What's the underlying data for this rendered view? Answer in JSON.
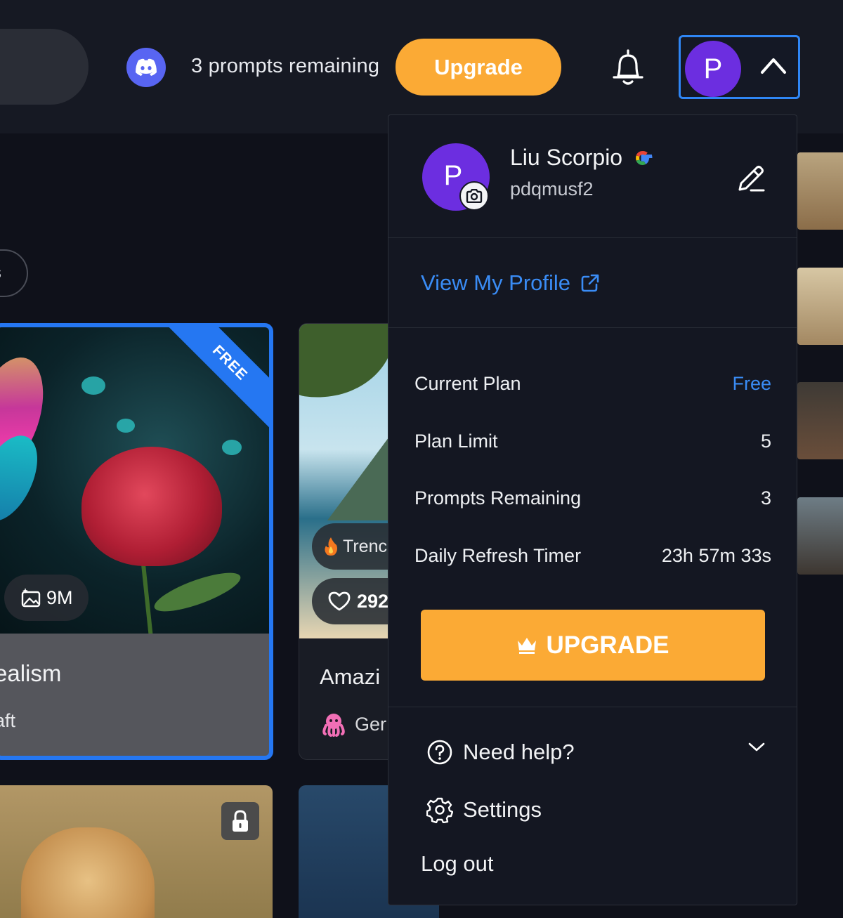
{
  "header": {
    "prompts_text": "3 prompts remaining",
    "upgrade_label": "Upgrade",
    "avatar_initial": "P"
  },
  "background": {
    "chip_text": "s",
    "card1": {
      "badge": "FREE",
      "stat": "9M",
      "title": "ealism",
      "subtitle": "aft"
    },
    "card2": {
      "trend": "Trenc",
      "likes": "292",
      "title": "Amazi",
      "subtitle": "Ger"
    }
  },
  "dropdown": {
    "user": {
      "initial": "P",
      "name": "Liu Scorpio",
      "handle": "pdqmusf2"
    },
    "view_profile": "View My Profile",
    "plan": {
      "current_plan_label": "Current Plan",
      "current_plan_value": "Free",
      "plan_limit_label": "Plan Limit",
      "plan_limit_value": "5",
      "prompts_remaining_label": "Prompts Remaining",
      "prompts_remaining_value": "3",
      "refresh_label": "Daily Refresh Timer",
      "refresh_value": "23h 57m 33s"
    },
    "upgrade_button": "UPGRADE",
    "menu": {
      "help": "Need help?",
      "settings": "Settings",
      "logout": "Log out"
    }
  },
  "colors": {
    "accent_orange": "#fbaa35",
    "accent_blue": "#3a8cf5",
    "avatar_purple": "#6c2ee0",
    "discord": "#5865f2"
  }
}
